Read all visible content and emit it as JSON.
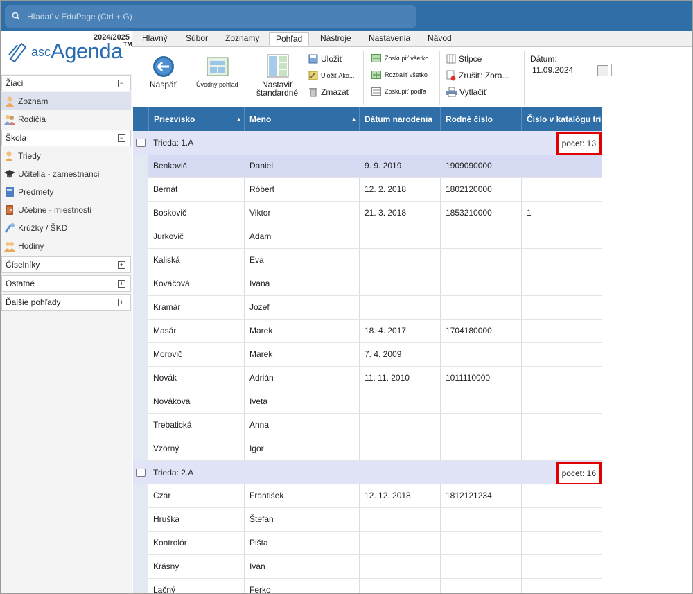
{
  "search": {
    "placeholder": "Hľadať v EduPage (Ctrl + G)"
  },
  "app": {
    "year": "2024/2025",
    "logo_small": "asc",
    "logo_big": "Agenda",
    "logo_tm": "TM"
  },
  "sidebar": {
    "sections": [
      {
        "label": "Žiaci",
        "toggle": "−"
      },
      {
        "label": "Škola",
        "toggle": "−"
      },
      {
        "label": "Číselníky",
        "toggle": "+"
      },
      {
        "label": "Ostatné",
        "toggle": "+"
      },
      {
        "label": "Ďalšie pohľady",
        "toggle": "+"
      }
    ],
    "ziaci_items": [
      {
        "label": "Zoznam"
      },
      {
        "label": "Rodičia"
      }
    ],
    "skola_items": [
      {
        "label": "Triedy"
      },
      {
        "label": "Učitelia - zamestnanci"
      },
      {
        "label": "Predmety"
      },
      {
        "label": "Učebne - miestnosti"
      },
      {
        "label": "Krúžky / ŠKD"
      },
      {
        "label": "Hodiny"
      }
    ]
  },
  "tabs": [
    "Hlavný",
    "Súbor",
    "Zoznamy",
    "Pohľad",
    "Nástroje",
    "Nastavenia",
    "Návod"
  ],
  "ribbon": {
    "back": "Naspäť",
    "intro": "Úvodný pohľad",
    "set_std_1": "Nastaviť",
    "set_std_2": "štandardné",
    "save": "Uložiť",
    "save_as": "Uložiť Ako...",
    "delete": "Zmazať",
    "group_all": "Zoskupiť všetko",
    "expand_all": "Rozbaliť všetko",
    "group_by": "Zoskupiť podľa",
    "columns": "Stĺpce",
    "cancel_sort": "Zrušiť: Zora...",
    "print": "Vytlačiť",
    "date_label": "Dátum:",
    "date_value": "11.09.2024"
  },
  "table": {
    "headers": [
      "Priezvisko",
      "Meno",
      "Dátum narodenia",
      "Rodné číslo",
      "Číslo v katalógu tri"
    ],
    "groups": [
      {
        "title": "Trieda: 1.A",
        "count": "počet: 13",
        "rows": [
          [
            "Benkovič",
            "Daniel",
            "9. 9. 2019",
            "1909090000",
            ""
          ],
          [
            "Bernát",
            "Róbert",
            "12. 2. 2018",
            "1802120000",
            ""
          ],
          [
            "Boskovič",
            "Viktor",
            "21. 3. 2018",
            "1853210000",
            "1"
          ],
          [
            "Jurkovič",
            "Adam",
            "",
            "",
            ""
          ],
          [
            "Kaliská",
            "Eva",
            "",
            "",
            ""
          ],
          [
            "Kováčová",
            "Ivana",
            "",
            "",
            ""
          ],
          [
            "Kramár",
            "Jozef",
            "",
            "",
            ""
          ],
          [
            "Masár",
            "Marek",
            "18. 4. 2017",
            "1704180000",
            ""
          ],
          [
            "Morovič",
            "Marek",
            "7. 4. 2009",
            "",
            ""
          ],
          [
            "Novák",
            "Adrián",
            "11. 11. 2010",
            "1011110000",
            ""
          ],
          [
            "Nováková",
            "Iveta",
            "",
            "",
            ""
          ],
          [
            "Trebatická",
            "Anna",
            "",
            "",
            ""
          ],
          [
            "Vzorný",
            "Igor",
            "",
            "",
            ""
          ]
        ]
      },
      {
        "title": "Trieda: 2.A",
        "count": "počet: 16",
        "rows": [
          [
            "Czár",
            "František",
            "12. 12. 2018",
            "1812121234",
            ""
          ],
          [
            "Hruška",
            "Štefan",
            "",
            "",
            ""
          ],
          [
            "Kontrolór",
            "Pišta",
            "",
            "",
            ""
          ],
          [
            "Krásny",
            "Ivan",
            "",
            "",
            ""
          ],
          [
            "Lačný",
            "Ferko",
            "",
            "",
            ""
          ]
        ]
      }
    ]
  }
}
